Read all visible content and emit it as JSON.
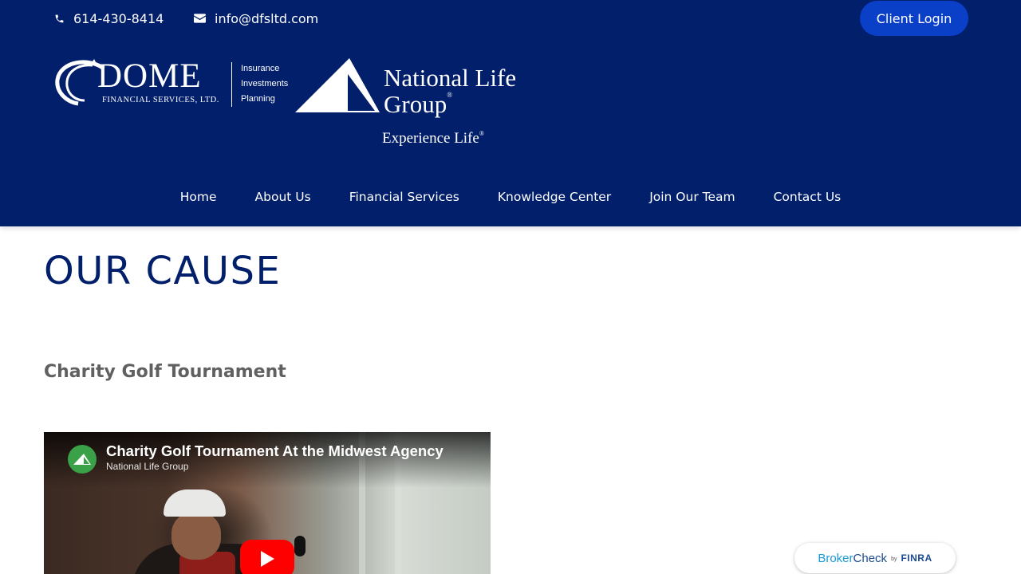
{
  "topbar": {
    "phone": "614-430-8414",
    "email": "info@dfsltd.com",
    "client_login": "Client Login"
  },
  "logo": {
    "dome_word": "DOME",
    "dome_sub": "FINANCIAL SERVICES, LTD.",
    "dome_tags": [
      "Insurance",
      "Investments",
      "Planning"
    ],
    "nlg_line1": "National Life",
    "nlg_line2": "Group",
    "nlg_tagline": "Experience Life",
    "registered_mark": "®"
  },
  "nav": {
    "items": [
      {
        "label": "Home"
      },
      {
        "label": "About Us"
      },
      {
        "label": "Financial Services"
      },
      {
        "label": "Knowledge Center"
      },
      {
        "label": "Join Our Team"
      },
      {
        "label": "Contact Us"
      }
    ]
  },
  "main": {
    "page_title": "OUR CAUSE",
    "section_heading": "Charity Golf Tournament"
  },
  "video": {
    "title": "Charity Golf Tournament At the Midwest Agency",
    "channel": "National Life Group",
    "play_icon": "play-icon"
  },
  "brokercheck": {
    "broker": "Broker",
    "check": "Check",
    "by": "by",
    "finra": "FINRA"
  },
  "colors": {
    "header_bg": "#021f6b",
    "button_blue": "#0a3fc8",
    "heading_gray": "#606060",
    "youtube_red": "#ff0000"
  }
}
